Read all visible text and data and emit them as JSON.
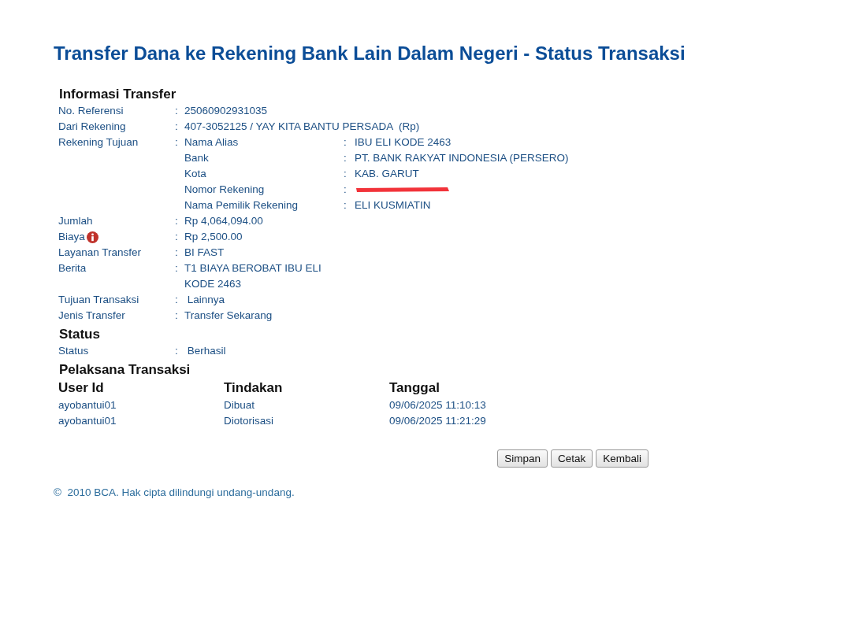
{
  "title": "Transfer Dana ke Rekening Bank Lain Dalam Negeri - Status Transaksi",
  "transfer_info": {
    "heading": "Informasi Transfer",
    "rows": [
      {
        "label": "No. Referensi",
        "sep": ":",
        "lines": [
          "25060902931035"
        ]
      },
      {
        "label": "Dari Rekening",
        "sep": ":",
        "lines": [
          "407-3052125 / YAY KITA BANTU PERSADA  (Rp)"
        ]
      },
      {
        "label": "Rekening Tujuan",
        "sep": ":",
        "details": [
          {
            "kind": "text",
            "label": "Nama Alias",
            "sep": ":",
            "value": "IBU ELI KODE 2463"
          },
          {
            "kind": "text",
            "label": "Bank",
            "sep": ":",
            "value": "PT. BANK RAKYAT INDONESIA (PERSERO)"
          },
          {
            "kind": "text",
            "label": "Kota",
            "sep": ":",
            "value": "KAB. GARUT"
          },
          {
            "kind": "redacted",
            "label": "Nomor Rekening",
            "sep": ":"
          },
          {
            "kind": "text",
            "label": "Nama Pemilik Rekening",
            "sep": ":",
            "value": "ELI KUSMIATIN"
          }
        ]
      },
      {
        "label": "Jumlah",
        "sep": ":",
        "lines": [
          "Rp 4,064,094.00"
        ]
      },
      {
        "label": "Biaya",
        "sep": ":",
        "info": true,
        "lines": [
          "Rp 2,500.00"
        ]
      },
      {
        "label": "Layanan Transfer",
        "sep": ":",
        "lines": [
          "BI FAST"
        ]
      },
      {
        "label": "Berita",
        "sep": ":",
        "lines": [
          "T1 BIAYA BEROBAT IBU ELI",
          "KODE 2463"
        ]
      },
      {
        "label": "Tujuan Transaksi",
        "sep": ":",
        "lines": [
          " Lainnya"
        ]
      },
      {
        "label": "Jenis Transfer",
        "sep": ":",
        "lines": [
          "Transfer Sekarang"
        ]
      }
    ]
  },
  "status": {
    "heading": "Status",
    "rows": [
      {
        "label": "Status",
        "sep": ":",
        "lines": [
          " Berhasil"
        ]
      }
    ]
  },
  "executors": {
    "heading": "Pelaksana Transaksi",
    "columns": [
      "User Id",
      "Tindakan",
      "Tanggal"
    ],
    "rows": [
      [
        "ayobantui01",
        "Dibuat",
        "09/06/2025 11:10:13"
      ],
      [
        "ayobantui01",
        "Diotorisasi",
        "09/06/2025 11:21:29"
      ]
    ]
  },
  "buttons": [
    "Simpan",
    "Cetak",
    "Kembali"
  ],
  "footer": "©  2010 BCA. Hak cipta dilindungi undang-undang."
}
